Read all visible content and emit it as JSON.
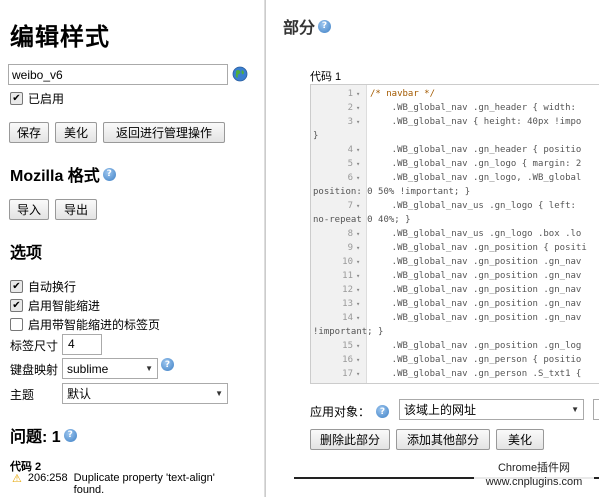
{
  "left": {
    "title": "编辑样式",
    "name_value": "weibo_v6",
    "enabled_label": "已启用",
    "buttons": {
      "save": "保存",
      "beautify": "美化",
      "back": "返回进行管理操作"
    },
    "mozilla": {
      "title": "Mozilla 格式",
      "import": "导入",
      "export": "导出"
    },
    "options": {
      "title": "选项",
      "wrap_label": "自动换行",
      "smart_indent_label": "启用智能缩进",
      "tab_indent_label": "启用带智能缩进的标签页",
      "tab_size_label": "标签尺寸",
      "tab_size_value": "4",
      "keymap_label": "键盘映射",
      "keymap_value": "sublime",
      "theme_label": "主题",
      "theme_value": "默认"
    },
    "issues": {
      "title": "问题: 1",
      "code_label": "代码 2",
      "position": "206:258",
      "message_line1": "Duplicate property 'text-align'",
      "message_line2": "found."
    }
  },
  "right": {
    "title": "部分",
    "code_label": "代码 1",
    "lines": [
      {
        "n": "1",
        "code": "/* navbar */",
        "comment": true
      },
      {
        "n": "2",
        "code": "    .WB_global_nav .gn_header { width:"
      },
      {
        "n": "3",
        "code": "    .WB_global_nav { height: 40px !impo",
        "wrap": "}"
      },
      {
        "n": "4",
        "code": "    .WB_global_nav .gn_header { positio"
      },
      {
        "n": "5",
        "code": "    .WB_global_nav .gn_logo { margin: 2"
      },
      {
        "n": "6",
        "code": "    .WB_global_nav .gn_logo, .WB_global",
        "wrap": "position: 0 50% !important; }"
      },
      {
        "n": "7",
        "code": "    .WB_global_nav_us .gn_logo { left:",
        "wrap": "no-repeat 0 40%; }"
      },
      {
        "n": "8",
        "code": "    .WB_global_nav_us .gn_logo .box .lo"
      },
      {
        "n": "9",
        "code": "    .WB_global_nav .gn_position { positi"
      },
      {
        "n": "10",
        "code": "    .WB_global_nav .gn_position .gn_nav"
      },
      {
        "n": "11",
        "code": "    .WB_global_nav .gn_position .gn_nav"
      },
      {
        "n": "12",
        "code": "    .WB_global_nav .gn_position .gn_nav"
      },
      {
        "n": "13",
        "code": "    .WB_global_nav .gn_position .gn_nav"
      },
      {
        "n": "14",
        "code": "    .WB_global_nav .gn_position .gn_nav",
        "wrap": "!important; }"
      },
      {
        "n": "15",
        "code": "    .WB_global_nav .gn_position .gn_log"
      },
      {
        "n": "16",
        "code": "    .WB_global_nav .gn_person { positio"
      },
      {
        "n": "17",
        "code": "    .WB_global_nav .gn_person .S_txt1 {"
      }
    ],
    "apply_label": "应用对象：",
    "apply_value": "该域上的网址",
    "buttons": {
      "delete": "删除此部分",
      "add": "添加其他部分",
      "beautify": "美化"
    }
  },
  "watermark": {
    "line1": "Chrome插件网",
    "line2": "www.cnplugins.com"
  },
  "colors": {
    "help_icon": "#3d7fc4",
    "warning": "#e5a400",
    "comment": "#a35a00"
  }
}
